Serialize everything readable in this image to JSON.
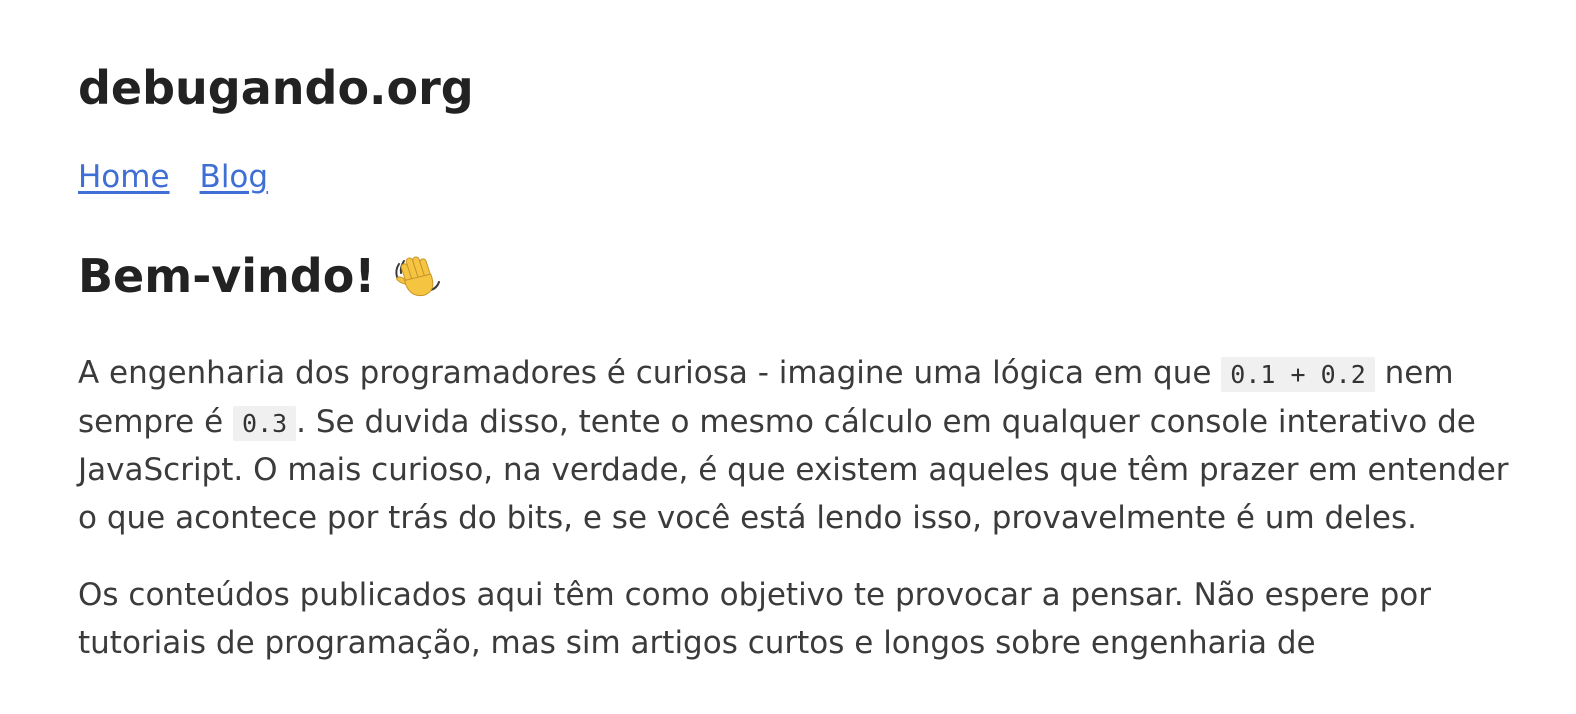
{
  "site": {
    "title": "debugando.org"
  },
  "nav": {
    "home_label": "Home",
    "blog_label": "Blog"
  },
  "main": {
    "heading": "Bem-vindo!",
    "heading_icon": "waving-hand-icon",
    "intro": {
      "t1": "A engenharia dos programadores é curiosa - imagine uma lógica em que ",
      "code1": "0.1 + 0.2",
      "t2": " nem sempre é ",
      "code2": "0.3",
      "t3": ". Se duvida disso, tente o mesmo cálculo em qualquer console interativo de JavaScript. O mais curioso, na verdade, é que existem aqueles que têm prazer em entender o que acontece por trás do bits, e se você está lendo isso, provavelmente é um deles."
    },
    "second_paragraph": "Os conteúdos publicados aqui têm como objetivo te provocar a pensar. Não espere por tutoriais de programação, mas sim artigos curtos e longos sobre engenharia de"
  },
  "colors": {
    "link": "#3f6fd4",
    "heading": "#222222",
    "text": "#3b3b3b",
    "code_bg": "#f0f0f0"
  }
}
